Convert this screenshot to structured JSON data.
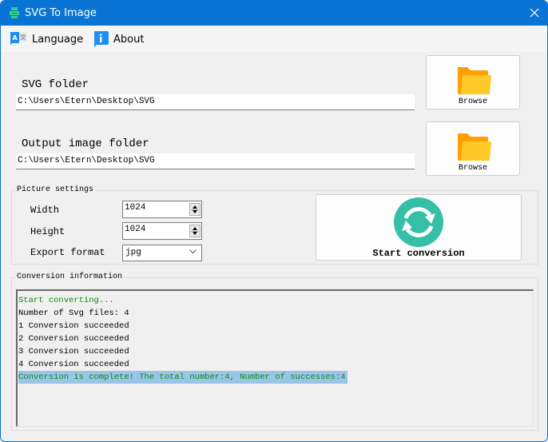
{
  "window": {
    "title": "SVG To Image",
    "app_icon": "printer-icon",
    "close_icon": "close-icon"
  },
  "menu": {
    "items": [
      {
        "label": "Language",
        "icon": "language-icon"
      },
      {
        "label": "About",
        "icon": "info-icon"
      }
    ]
  },
  "svg_folder": {
    "label": "SVG folder",
    "value": "C:\\Users\\Etern\\Desktop\\SVG",
    "browse_label": "Browse",
    "browse_icon": "folder-icon"
  },
  "output_folder": {
    "label": "Output image folder",
    "value": "C:\\Users\\Etern\\Desktop\\SVG",
    "browse_label": "Browse",
    "browse_icon": "folder-icon"
  },
  "picture_settings": {
    "title": "Picture settings",
    "width_label": "Width",
    "width_value": "1024",
    "height_label": "Height",
    "height_value": "1024",
    "format_label": "Export format",
    "format_value": "jpg"
  },
  "start_button": {
    "label": "Start conversion",
    "icon": "refresh-icon",
    "icon_color": "#36bfa7"
  },
  "conversion_info": {
    "title": "Conversion information",
    "lines": [
      {
        "text": "Start converting...",
        "color": "green"
      },
      {
        "text": "Number of Svg files: 4",
        "color": "black"
      },
      {
        "text": "1 Conversion succeeded",
        "color": "black"
      },
      {
        "text": "2 Conversion succeeded",
        "color": "black"
      },
      {
        "text": "3 Conversion succeeded",
        "color": "black"
      },
      {
        "text": "4 Conversion succeeded",
        "color": "black"
      },
      {
        "text": "Conversion is complete! The total number:4, Number of successes:4",
        "color": "green",
        "selected": true
      }
    ]
  },
  "colors": {
    "titlebar": "#0a74d4",
    "success_text": "#118811",
    "selection": "#99c5e8",
    "folder_dark": "#ffa000",
    "folder_light": "#ffca28"
  }
}
